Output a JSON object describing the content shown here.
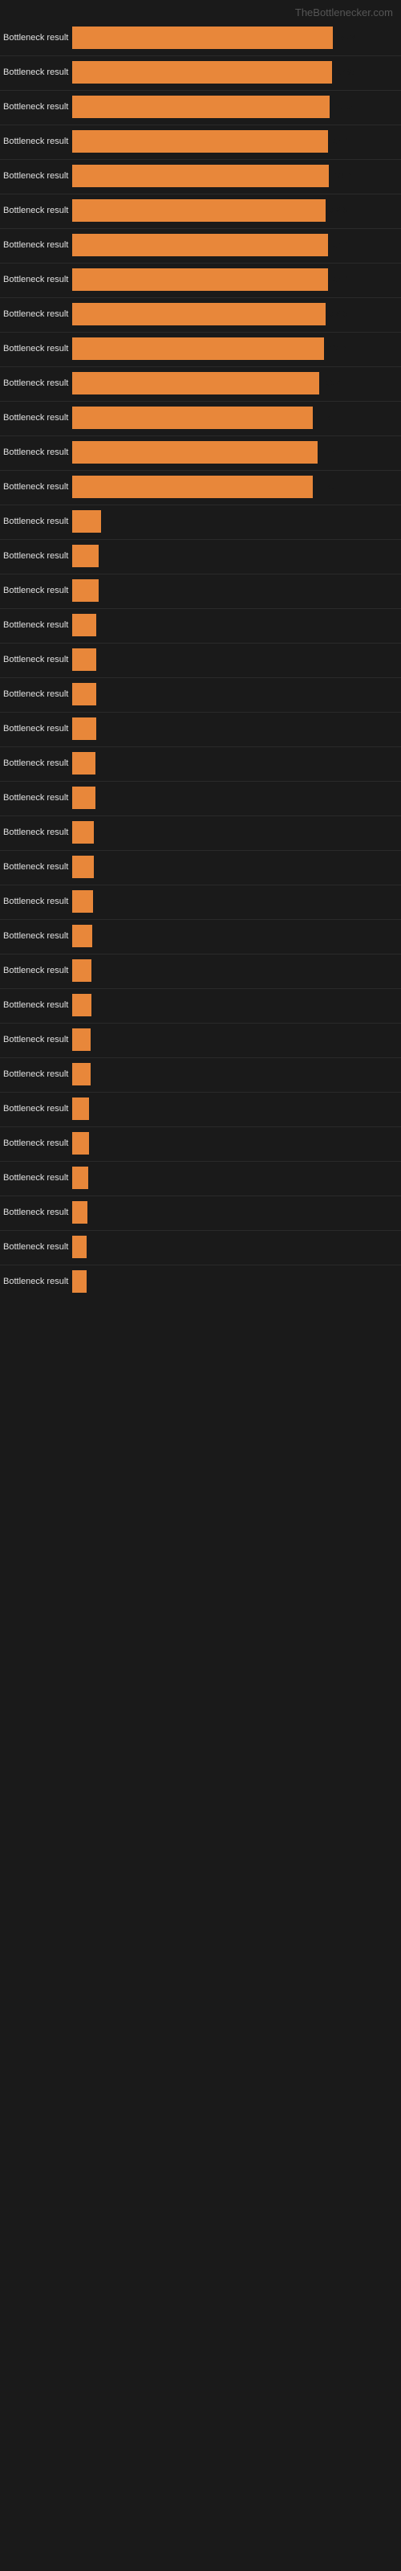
{
  "header": {
    "title": "TheBottlenecker.com"
  },
  "bars": [
    {
      "label": "Bottleneck result",
      "value": 54.2,
      "display": "54.2",
      "width_pct": 54.2
    },
    {
      "label": "Bottleneck result",
      "value": 54.0,
      "display": "54%",
      "width_pct": 54.0
    },
    {
      "label": "Bottleneck result",
      "value": 53.5,
      "display": "53.5",
      "width_pct": 53.5
    },
    {
      "label": "Bottleneck result",
      "value": 53.1,
      "display": "53.1",
      "width_pct": 53.1
    },
    {
      "label": "Bottleneck result",
      "value": 53.3,
      "display": "53.3",
      "width_pct": 53.3
    },
    {
      "label": "Bottleneck result",
      "value": 52.6,
      "display": "52.6",
      "width_pct": 52.6
    },
    {
      "label": "Bottleneck result",
      "value": 53.1,
      "display": "53.1",
      "width_pct": 53.1
    },
    {
      "label": "Bottleneck result",
      "value": 53.1,
      "display": "53.1",
      "width_pct": 53.1
    },
    {
      "label": "Bottleneck result",
      "value": 52.6,
      "display": "52.6",
      "width_pct": 52.6
    },
    {
      "label": "Bottleneck result",
      "value": 52.3,
      "display": "52.3",
      "width_pct": 52.3
    },
    {
      "label": "Bottleneck result",
      "value": 51.4,
      "display": "51.4",
      "width_pct": 51.4
    },
    {
      "label": "Bottleneck result",
      "value": 50.0,
      "display": "50",
      "width_pct": 50.0
    },
    {
      "label": "Bottleneck result",
      "value": 51.0,
      "display": "51",
      "width_pct": 51.0
    },
    {
      "label": "Bottleneck result",
      "value": 50.0,
      "display": "50",
      "width_pct": 50.0
    },
    {
      "label": "Bottleneck result",
      "value": 6.0,
      "display": "",
      "width_pct": 6.0
    },
    {
      "label": "Bottleneck result",
      "value": 5.5,
      "display": "",
      "width_pct": 5.5
    },
    {
      "label": "Bottleneck result",
      "value": 5.5,
      "display": "",
      "width_pct": 5.5
    },
    {
      "label": "Bottleneck result",
      "value": 5.0,
      "display": "",
      "width_pct": 5.0
    },
    {
      "label": "Bottleneck result",
      "value": 5.0,
      "display": "",
      "width_pct": 5.0
    },
    {
      "label": "Bottleneck result",
      "value": 5.0,
      "display": "",
      "width_pct": 5.0
    },
    {
      "label": "Bottleneck result",
      "value": 5.0,
      "display": "",
      "width_pct": 5.0
    },
    {
      "label": "Bottleneck result",
      "value": 4.8,
      "display": "",
      "width_pct": 4.8
    },
    {
      "label": "Bottleneck result",
      "value": 4.8,
      "display": "",
      "width_pct": 4.8
    },
    {
      "label": "Bottleneck result",
      "value": 4.5,
      "display": "",
      "width_pct": 4.5
    },
    {
      "label": "Bottleneck result",
      "value": 4.5,
      "display": "",
      "width_pct": 4.5
    },
    {
      "label": "Bottleneck result",
      "value": 4.3,
      "display": "",
      "width_pct": 4.3
    },
    {
      "label": "Bottleneck result",
      "value": 4.2,
      "display": "",
      "width_pct": 4.2
    },
    {
      "label": "Bottleneck result",
      "value": 4.0,
      "display": "",
      "width_pct": 4.0
    },
    {
      "label": "Bottleneck result",
      "value": 4.0,
      "display": "",
      "width_pct": 4.0
    },
    {
      "label": "Bottleneck result",
      "value": 3.8,
      "display": "",
      "width_pct": 3.8
    },
    {
      "label": "Bottleneck result",
      "value": 3.8,
      "display": "",
      "width_pct": 3.8
    },
    {
      "label": "Bottleneck result",
      "value": 3.5,
      "display": "",
      "width_pct": 3.5
    },
    {
      "label": "Bottleneck result",
      "value": 3.5,
      "display": "",
      "width_pct": 3.5
    },
    {
      "label": "Bottleneck result",
      "value": 3.3,
      "display": "",
      "width_pct": 3.3
    },
    {
      "label": "Bottleneck result",
      "value": 3.2,
      "display": "",
      "width_pct": 3.2
    },
    {
      "label": "Bottleneck result",
      "value": 3.0,
      "display": "",
      "width_pct": 3.0
    },
    {
      "label": "Bottleneck result",
      "value": 3.0,
      "display": "",
      "width_pct": 3.0
    }
  ]
}
